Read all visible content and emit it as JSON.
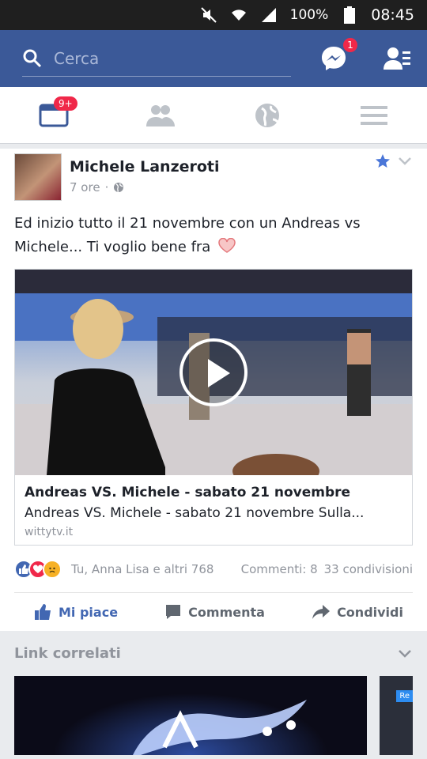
{
  "status_bar": {
    "battery": "100%",
    "time": "08:45"
  },
  "search": {
    "placeholder": "Cerca"
  },
  "messenger": {
    "badge": "1"
  },
  "tabs": {
    "news_badge": "9+"
  },
  "post": {
    "author": "Michele Lanzeroti",
    "time": "7 ore",
    "text": "Ed inizio tutto il 21 novembre con un Andreas vs Michele... Ti voglio bene fra",
    "link": {
      "title": "Andreas VS. Michele - sabato 21 novembre",
      "description": "Andreas VS. Michele - sabato 21 novembre Sulla...",
      "domain": "wittytv.it"
    },
    "reactions_text": "Tu, Anna Lisa e altri 768",
    "comments": "Commenti: 8",
    "shares": "33 condivisioni",
    "actions": {
      "like": "Mi piace",
      "comment": "Commenta",
      "share": "Condividi"
    }
  },
  "related": {
    "title": "Link correlati",
    "card_tag": "Re"
  },
  "colors": {
    "brand": "#3b5998",
    "badge": "#f02849",
    "like": "#4267b2"
  }
}
